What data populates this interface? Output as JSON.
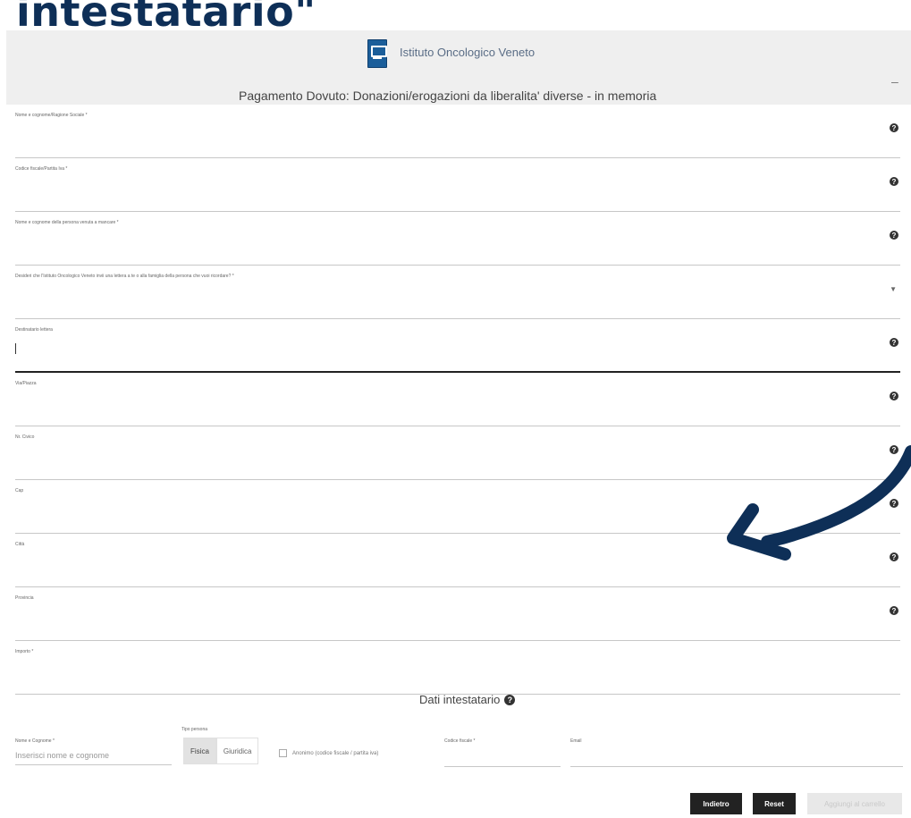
{
  "overlay": {
    "title": "intestatario\""
  },
  "header": {
    "org_name": "Istituto Oncologico Veneto",
    "page_title": "Pagamento Dovuto: Donazioni/erogazioni da liberalita' diverse - in memoria",
    "collapse_symbol": "–"
  },
  "form": {
    "fields": [
      {
        "label": "Nome e cognome/Ragione Sociale *",
        "control": "text"
      },
      {
        "label": "Codice fiscale/Partita Iva *",
        "control": "text"
      },
      {
        "label": "Nome e cognome della persona venuta a mancare *",
        "control": "text"
      },
      {
        "label": "Desideri che l'Istituto Oncologico Veneto invii una lettera a te o alla famiglia della persona che vuoi ricordare? *",
        "control": "select"
      },
      {
        "label": "Destinatario lettera",
        "control": "text",
        "active": true
      },
      {
        "label": "Via/Piazza",
        "control": "text"
      },
      {
        "label": "Nr. Civico",
        "control": "text"
      },
      {
        "label": "Cap",
        "control": "text"
      },
      {
        "label": "Città",
        "control": "text"
      },
      {
        "label": "Provincia",
        "control": "text"
      },
      {
        "label": "Importo *",
        "control": "text"
      }
    ]
  },
  "intestatario": {
    "title": "Dati intestatario",
    "name_label": "Nome e Cognome *",
    "name_placeholder": "Inserisci nome e cognome",
    "person_type_label": "Tipo persona",
    "person_types": [
      "Fisica",
      "Giuridica"
    ],
    "selected_person_type": "Fisica",
    "no_cf_label": "Anonimo (codice fiscale / partita iva)",
    "cf_label": "Codice fiscale *",
    "email_label": "Email"
  },
  "buttons": {
    "back": "Indietro",
    "reset": "Reset",
    "add_to_cart": "Aggiungi al carrello"
  },
  "icons": {
    "help": "question-circle-icon",
    "select": "chevron-down-icon",
    "logo": "institute-logo-icon",
    "arrow": "curved-arrow-icon"
  },
  "colors": {
    "overlay_title": "#0e2f57",
    "arrow": "#0e2f57",
    "header_bg": "#efefef",
    "button_bg": "#222222",
    "logo": "#1b5e9a"
  }
}
